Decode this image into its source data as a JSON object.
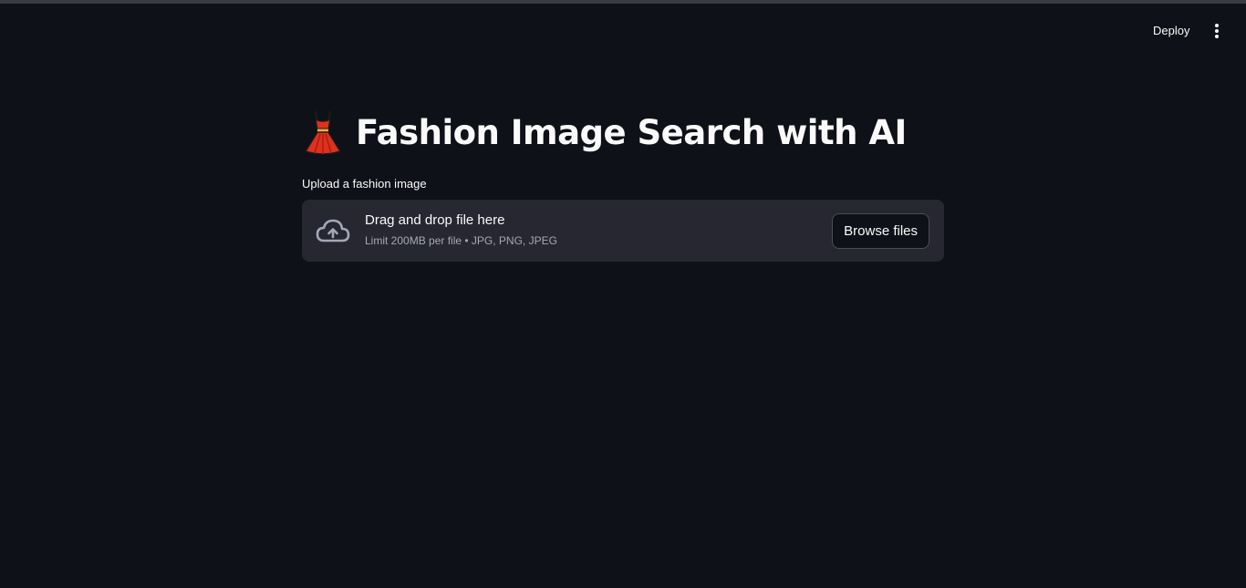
{
  "header": {
    "deploy_label": "Deploy",
    "menu_icon": "vertical-ellipsis-icon"
  },
  "main": {
    "title_icon": "dress-icon",
    "title": "Fashion Image Search with AI",
    "uploader": {
      "label": "Upload a fashion image",
      "icon": "cloud-upload-icon",
      "drop_title": "Drag and drop file here",
      "drop_hint": "Limit 200MB per file • JPG, PNG, JPEG",
      "browse_label": "Browse files"
    }
  },
  "colors": {
    "background": "#0e1117",
    "dropzone": "#262730",
    "text": "#fafafa",
    "muted_text": "#a3a8b8",
    "dress_red": "#e0301e"
  }
}
